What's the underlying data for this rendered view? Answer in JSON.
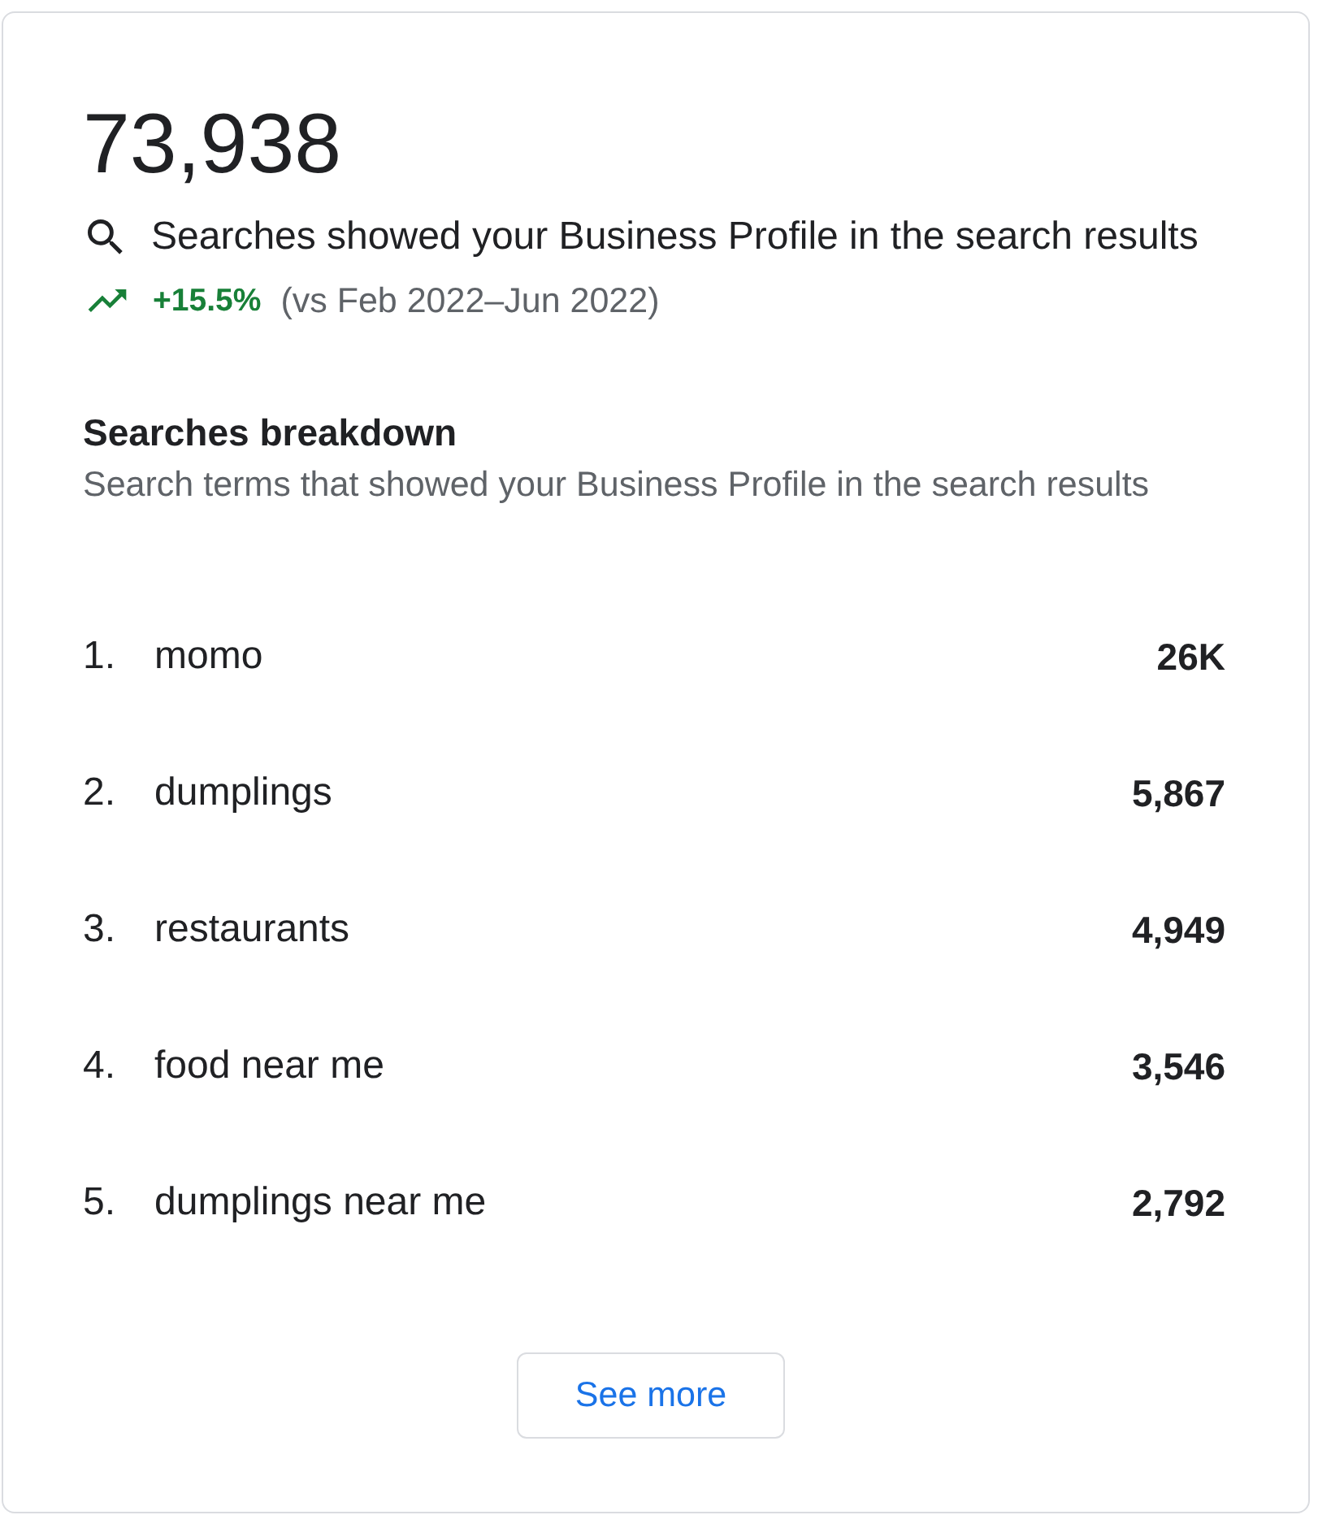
{
  "metric": {
    "value": "73,938",
    "description": "Searches showed your Business Profile in the search results",
    "change": {
      "positive": true,
      "value": "+15.5%",
      "comparison": "(vs Feb 2022–Jun 2022)"
    }
  },
  "breakdown": {
    "title": "Searches breakdown",
    "subtitle": "Search terms that showed your Business Profile in the search results",
    "rows": [
      {
        "rank": "1.",
        "term": "momo",
        "count": "26K"
      },
      {
        "rank": "2.",
        "term": "dumplings",
        "count": "5,867"
      },
      {
        "rank": "3.",
        "term": "restaurants",
        "count": "4,949"
      },
      {
        "rank": "4.",
        "term": "food near me",
        "count": "3,546"
      },
      {
        "rank": "5.",
        "term": "dumplings near me",
        "count": "2,792"
      }
    ]
  },
  "button": {
    "label": "See more"
  }
}
